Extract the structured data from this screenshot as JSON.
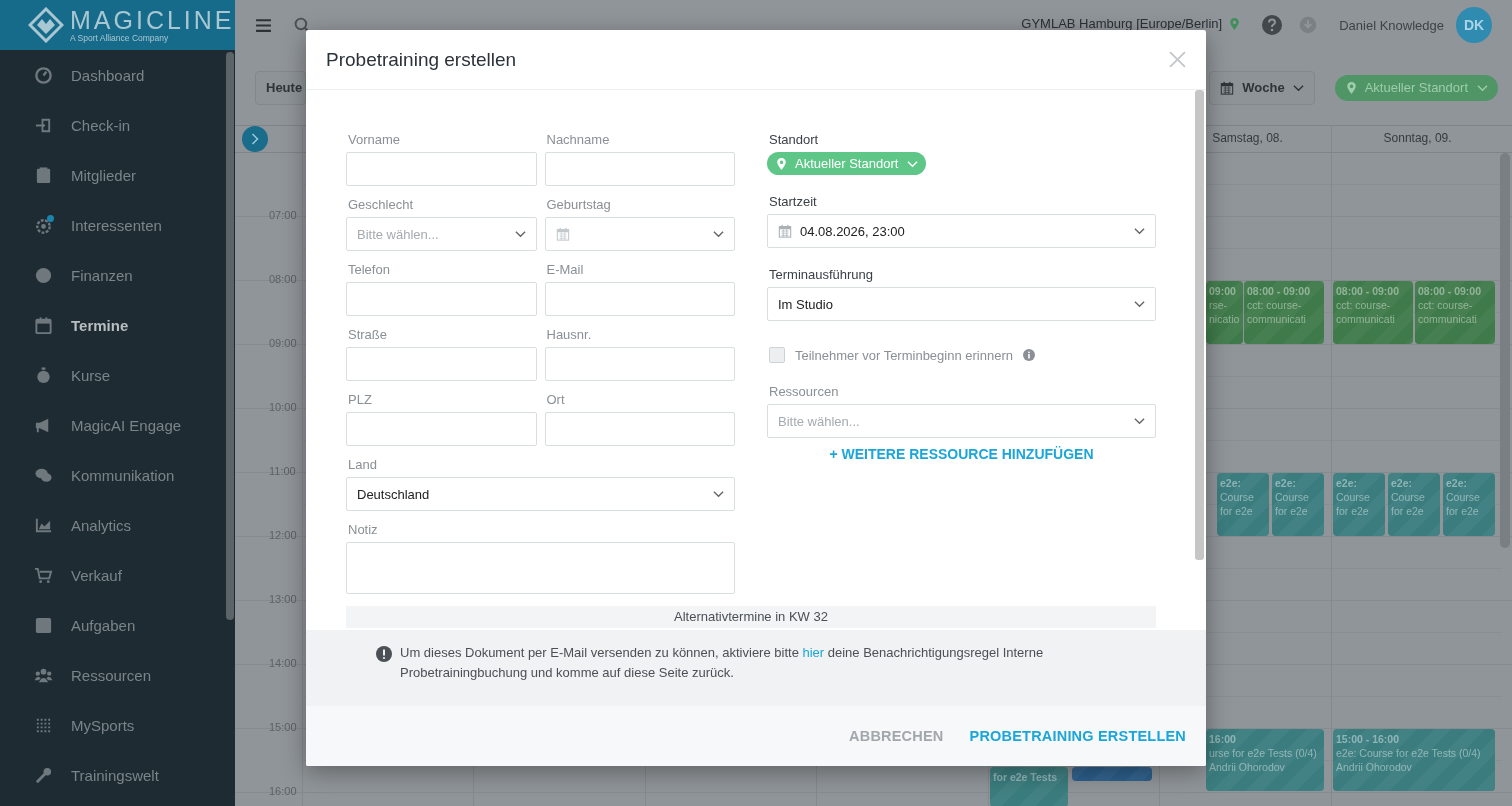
{
  "logo": {
    "name": "MAGICLINE",
    "tagline": "A Sport Alliance Company"
  },
  "sidebar": {
    "items": [
      {
        "label": "Dashboard",
        "selected": false,
        "notification": false
      },
      {
        "label": "Check-in",
        "selected": false,
        "notification": false
      },
      {
        "label": "Mitglieder",
        "selected": false,
        "notification": false
      },
      {
        "label": "Interessenten",
        "selected": false,
        "notification": true
      },
      {
        "label": "Finanzen",
        "selected": false,
        "notification": false
      },
      {
        "label": "Termine",
        "selected": true,
        "notification": false
      },
      {
        "label": "Kurse",
        "selected": false,
        "notification": false
      },
      {
        "label": "MagicAI Engage",
        "selected": false,
        "notification": false
      },
      {
        "label": "Kommunikation",
        "selected": false,
        "notification": false
      },
      {
        "label": "Analytics",
        "selected": false,
        "notification": false
      },
      {
        "label": "Verkauf",
        "selected": false,
        "notification": false
      },
      {
        "label": "Aufgaben",
        "selected": false,
        "notification": false
      },
      {
        "label": "Ressourcen",
        "selected": false,
        "notification": false
      },
      {
        "label": "MySports",
        "selected": false,
        "notification": false
      },
      {
        "label": "Trainingswelt",
        "selected": false,
        "notification": false
      }
    ]
  },
  "topbar": {
    "location": "GYMLAB Hamburg [Europe/Berlin]",
    "user": "Daniel Knowledge",
    "avatar": "DK"
  },
  "toolbar": {
    "today": "Heute",
    "view": "Woche",
    "location": "Aktueller Standort"
  },
  "calendar": {
    "days": [
      "Samstag, 08.",
      "Sonntag, 09."
    ],
    "hours": [
      "07:00",
      "08:00",
      "09:00",
      "10:00",
      "11:00",
      "12:00",
      "13:00",
      "14:00",
      "15:00",
      "16:00"
    ],
    "events": [
      {
        "lines": [
          "09:00",
          "rse-",
          "nicatio"
        ],
        "color": "#3f7a4a"
      },
      {
        "lines": [
          "08:00 - 09:00",
          "cct: course-",
          "communicati"
        ],
        "color": "#3f7a4a"
      },
      {
        "lines": [
          "08:00 - 09:00",
          "cct: course-",
          "communicati"
        ],
        "color": "#3f7a4a"
      },
      {
        "lines": [
          "08:00 - 09:00",
          "cct: course-",
          "communicati"
        ],
        "color": "#3f7a4a"
      },
      {
        "lines": [
          "e2e:",
          "Course",
          "for e2e"
        ],
        "color": "#3b7d7f"
      },
      {
        "lines": [
          "e2e:",
          "Course",
          "for e2e"
        ],
        "color": "#3b7d7f"
      },
      {
        "lines": [
          "e2e:",
          "Course",
          "for e2e"
        ],
        "color": "#3b7d7f"
      },
      {
        "lines": [
          "e2e:",
          "Course",
          "for e2e"
        ],
        "color": "#3b7d7f"
      },
      {
        "lines": [
          "e2e:",
          "Course",
          "for e2e"
        ],
        "color": "#3b7d7f"
      },
      {
        "lines": [
          "16:00",
          "urse for e2e Tests (0/4)",
          "Andrii Ohorodov"
        ],
        "color": "#3b7d7f"
      },
      {
        "lines": [
          "15:00 - 16:00",
          "e2e: Course for e2e Tests (0/4)",
          "Andrii Ohorodov"
        ],
        "color": "#3b7d7f"
      },
      {
        "lines": [
          "for e2e Tests"
        ],
        "color": "#3b7d7f"
      },
      {
        "color": "#2c5f8c"
      }
    ]
  },
  "modal": {
    "title": "Probetraining erstellen",
    "fields": [
      {
        "label": "Vorname",
        "kind": "text"
      },
      {
        "label": "Nachname",
        "kind": "text"
      },
      {
        "label": "Geschlecht",
        "kind": "select",
        "placeholder": "Bitte wählen..."
      },
      {
        "label": "Geburtstag",
        "kind": "date"
      },
      {
        "label": "Telefon",
        "kind": "text"
      },
      {
        "label": "E-Mail",
        "kind": "text"
      },
      {
        "label": "Straße",
        "kind": "text"
      },
      {
        "label": "Hausnr.",
        "kind": "text"
      },
      {
        "label": "PLZ",
        "kind": "text"
      },
      {
        "label": "Ort",
        "kind": "text"
      }
    ],
    "country": {
      "label": "Land",
      "value": "Deutschland"
    },
    "note": {
      "label": "Notiz"
    },
    "location": {
      "label": "Standort",
      "value": "Aktueller Standort"
    },
    "start": {
      "label": "Startzeit",
      "value": "04.08.2026, 23:00"
    },
    "execution": {
      "label": "Terminausführung",
      "value": "Im Studio"
    },
    "reminder": {
      "label": "Teilnehmer vor Terminbeginn erinnern",
      "checked": false,
      "disabled": true
    },
    "resources": {
      "label": "Ressourcen",
      "placeholder": "Bitte wählen..."
    },
    "add_resource": "+ WEITERE RESSOURCE HINZUFÜGEN",
    "alternatives": "Alternativtermine in KW 32",
    "notice": {
      "before": "Um dieses Dokument per E-Mail versenden zu können, aktiviere bitte ",
      "link": "hier",
      "after": " deine Benachrichtigungsregel Interne Probetrainingbuchung und komme auf diese Seite zurück."
    },
    "buttons": [
      {
        "label": "ABBRECHEN",
        "kind": "secondary"
      },
      {
        "label": "PROBETRAINING ERSTELLEN",
        "kind": "primary"
      }
    ]
  }
}
